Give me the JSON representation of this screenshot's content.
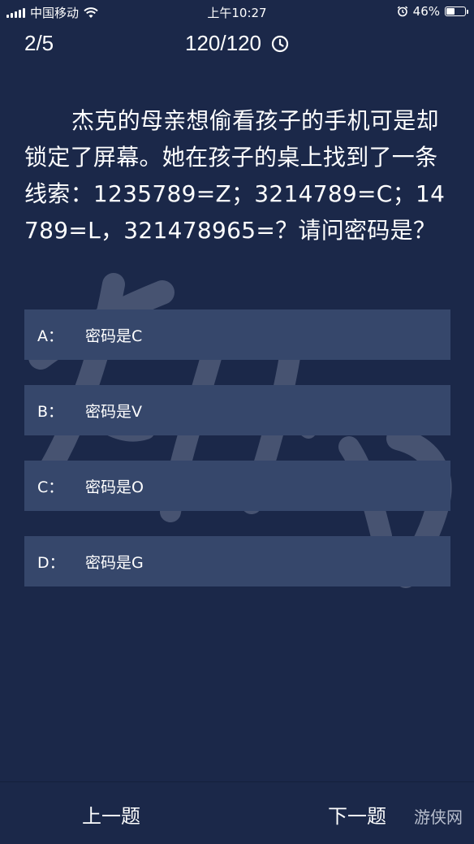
{
  "status_bar": {
    "carrier": "中国移动",
    "time": "上午10:27",
    "battery_percent": "46%",
    "battery_level": 0.46
  },
  "header": {
    "progress": "2/5",
    "timer": "120/120"
  },
  "question": {
    "text": "杰克的母亲想偷看孩子的手机可是却锁定了屏幕。她在孩子的桌上找到了一条线索：1235789=Z；3214789=C；14789=L，321478965=？请问密码是？"
  },
  "options": [
    {
      "letter": "A：",
      "text": "密码是C"
    },
    {
      "letter": "B：",
      "text": "密码是V"
    },
    {
      "letter": "C：",
      "text": "密码是O"
    },
    {
      "letter": "D：",
      "text": "密码是G"
    }
  ],
  "nav": {
    "prev": "上一题",
    "next": "下一题"
  },
  "watermark": {
    "corner": "游侠网"
  },
  "colors": {
    "background": "#1b2849",
    "option_bg": "#36476b",
    "text": "#ffffff"
  }
}
